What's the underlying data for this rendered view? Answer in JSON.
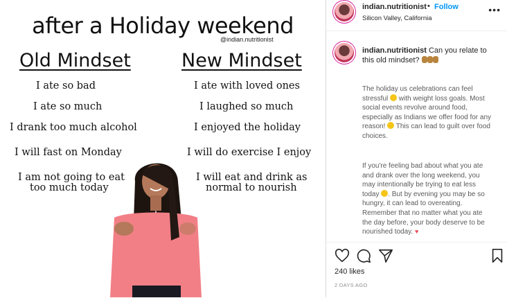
{
  "post": {
    "title": "after a Holiday weekend",
    "handle": "@indian.nutritionist",
    "old_heading": "Old Mindset",
    "new_heading": "New Mindset",
    "old_lines": [
      "I ate so bad",
      "I ate so much",
      "I drank too much alcohol",
      "I will fast on Monday",
      "I am not going to eat",
      "too much today"
    ],
    "new_lines": [
      "I ate with loved ones",
      "I laughed so much",
      "I enjoyed the holiday",
      "I will do exercise I enjoy",
      "I will eat and drink as",
      "normal to nourish"
    ]
  },
  "header": {
    "username": "indian.nutritionist",
    "separator": "•",
    "follow_label": "Follow",
    "location": "Silicon Valley, California",
    "more_label": "•••"
  },
  "caption": {
    "username": "indian.nutritionist",
    "intro": "Can you relate to this old mindset?",
    "para1_a": "The holiday us celebrations can feel stressful",
    "para1_b": "with weight loss goals. Most social events revolve around food, especially as Indians we offer food for any reason!",
    "para1_c": "This can lead to guilt over food choices.",
    "para2_a": "If you're feeling bad about what you ate and drank over the long weekend, you may intentionally be trying to eat less today",
    "para2_b": ". But by evening you may be so hungry, it can lead to overeating. Remember that no matter what you ate the day before, your body deserve to be nourished today.",
    "heart": "♥"
  },
  "footer": {
    "likes": "240 likes",
    "timestamp": "2 DAYS AGO"
  },
  "colors": {
    "accent": "#0095f6",
    "shirt": "#f27f86",
    "text": "#262626"
  }
}
